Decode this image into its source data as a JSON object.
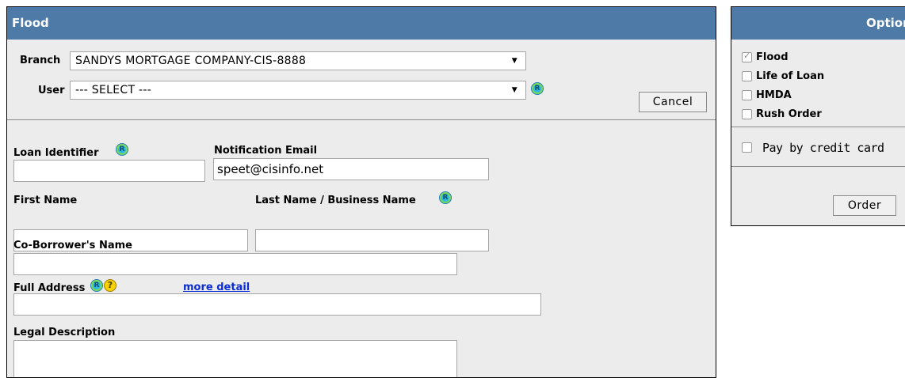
{
  "flood_panel": {
    "title": "Flood",
    "branch_label": "Branch",
    "branch_value": "SANDYS MORTGAGE COMPANY-CIS-8888",
    "user_label": "User",
    "user_value": "--- SELECT ---",
    "cancel_label": "Cancel",
    "loan_identifier_label": "Loan Identifier",
    "loan_identifier_value": "",
    "notification_email_label": "Notification Email",
    "notification_email_value": "speet@cisinfo.net",
    "first_name_label": "First Name",
    "first_name_value": "",
    "last_name_label": "Last Name / Business Name",
    "last_name_value": "",
    "co_borrower_label": "Co-Borrower's Name",
    "co_borrower_value": "",
    "full_address_label": "Full Address",
    "full_address_value": "",
    "more_detail_label": "more detail",
    "legal_description_label": "Legal Description",
    "legal_description_value": "",
    "required_icon_letter": "R",
    "help_icon_letter": "?"
  },
  "options_panel": {
    "title": "Options",
    "items": [
      {
        "label": "Flood",
        "checked": true,
        "disabled": true
      },
      {
        "label": "Life of Loan",
        "checked": false
      },
      {
        "label": "HMDA",
        "checked": false
      },
      {
        "label": "Rush Order",
        "checked": false
      }
    ],
    "pay_by_credit_card_label": "Pay by credit card",
    "pay_by_credit_card_checked": false,
    "order_label": "Order"
  },
  "colors": {
    "header_bg": "#4e7aa8",
    "panel_bg": "#ececec",
    "link": "#0a2dd6"
  }
}
